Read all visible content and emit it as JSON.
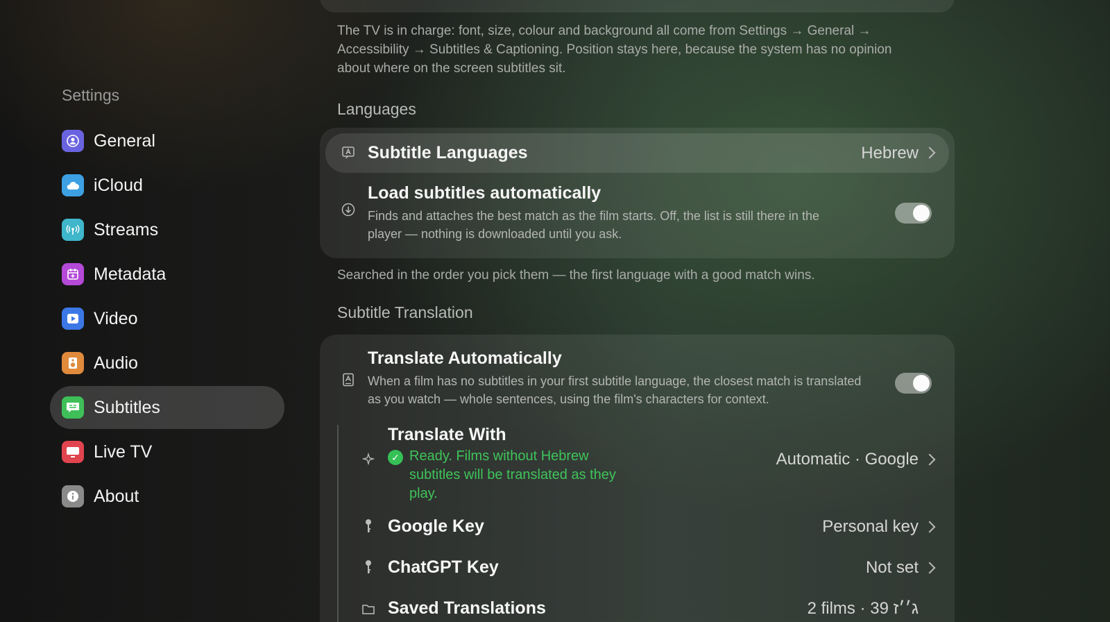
{
  "sidebar": {
    "title": "Settings",
    "items": [
      {
        "label": "General",
        "icon": "person-icon",
        "color": "#6a63e0"
      },
      {
        "label": "iCloud",
        "icon": "cloud-icon",
        "color": "#3da0e3"
      },
      {
        "label": "Streams",
        "icon": "antenna-icon",
        "color": "#3fb6c9"
      },
      {
        "label": "Metadata",
        "icon": "calendar-icon",
        "color": "#b549d8"
      },
      {
        "label": "Video",
        "icon": "play-icon",
        "color": "#3b78e6"
      },
      {
        "label": "Audio",
        "icon": "speaker-icon",
        "color": "#e08a3c"
      },
      {
        "label": "Subtitles",
        "icon": "subtitles-icon",
        "color": "#3fbf58",
        "selected": true
      },
      {
        "label": "Live TV",
        "icon": "tv-icon",
        "color": "#e0444f"
      },
      {
        "label": "About",
        "icon": "info-icon",
        "color": "#8a8a8a"
      }
    ]
  },
  "main": {
    "intro_text": "The TV is in charge: font, size, colour and background all come from Settings → General → Accessibility → Subtitles & Captioning. Position stays here, because the system has no opinion about where on the screen subtitles sit.",
    "languages": {
      "section_title": "Languages",
      "subtitle_languages": {
        "title": "Subtitle Languages",
        "value": "Hebrew"
      },
      "load_auto": {
        "title": "Load subtitles automatically",
        "subtitle": "Finds and attaches the best match as the film starts. Off, the list is still there in the player — nothing is downloaded until you ask.",
        "enabled": true
      },
      "footer": "Searched in the order you pick them — the first language with a good match wins."
    },
    "translation": {
      "section_title": "Subtitle Translation",
      "translate_auto": {
        "title": "Translate Automatically",
        "subtitle": "When a film has no subtitles in your first subtitle language, the closest match is translated as you watch — whole sentences, using the film's characters for context.",
        "enabled": true
      },
      "translate_with": {
        "title": "Translate With",
        "status": "Ready. Films without Hebrew subtitles will be translated as they play.",
        "value": "Automatic · Google"
      },
      "google_key": {
        "title": "Google Key",
        "value": "Personal key"
      },
      "chatgpt_key": {
        "title": "ChatGPT Key",
        "value": "Not set"
      },
      "saved_translations": {
        "title": "Saved Translations",
        "value": "2 films · ג׳׳ז 39"
      }
    }
  }
}
